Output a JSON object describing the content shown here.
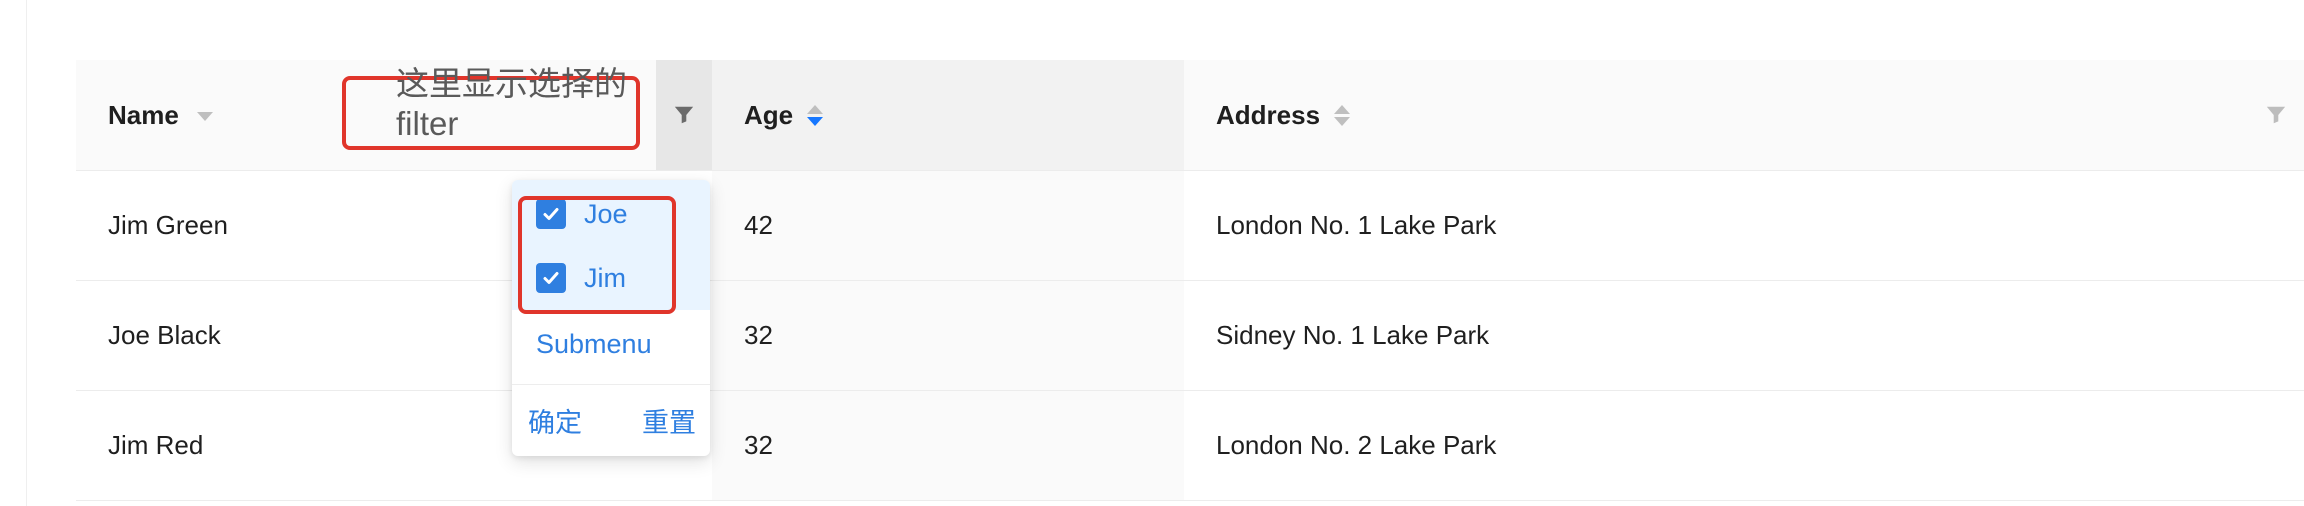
{
  "annotation": {
    "text": "这里显示选择的filter",
    "color": "#e0352b"
  },
  "table": {
    "columns": [
      {
        "key": "name",
        "label": "Name",
        "sorter": "down-only",
        "filter_active": true
      },
      {
        "key": "age",
        "label": "Age",
        "sorter": "descend-active"
      },
      {
        "key": "address",
        "label": "Address",
        "sorter": "both",
        "filter": true
      }
    ],
    "rows": [
      {
        "name": "Jim Green",
        "age": "42",
        "address": "London No. 1 Lake Park"
      },
      {
        "name": "Joe Black",
        "age": "32",
        "address": "Sidney No. 1 Lake Park"
      },
      {
        "name": "Jim Red",
        "age": "32",
        "address": "London No. 2 Lake Park"
      }
    ]
  },
  "filter_dropdown": {
    "items": [
      {
        "label": "Joe",
        "checked": true
      },
      {
        "label": "Jim",
        "checked": true
      }
    ],
    "submenu_label": "Submenu",
    "confirm_label": "确定",
    "reset_label": "重置"
  },
  "colors": {
    "primary": "#2f7fe0",
    "header_bg": "#fafafa",
    "selected_bg": "#e9f4ff"
  },
  "icons": {
    "column_filter": "funnel-icon",
    "checkbox": "check-icon",
    "sort": "caret-icon"
  }
}
